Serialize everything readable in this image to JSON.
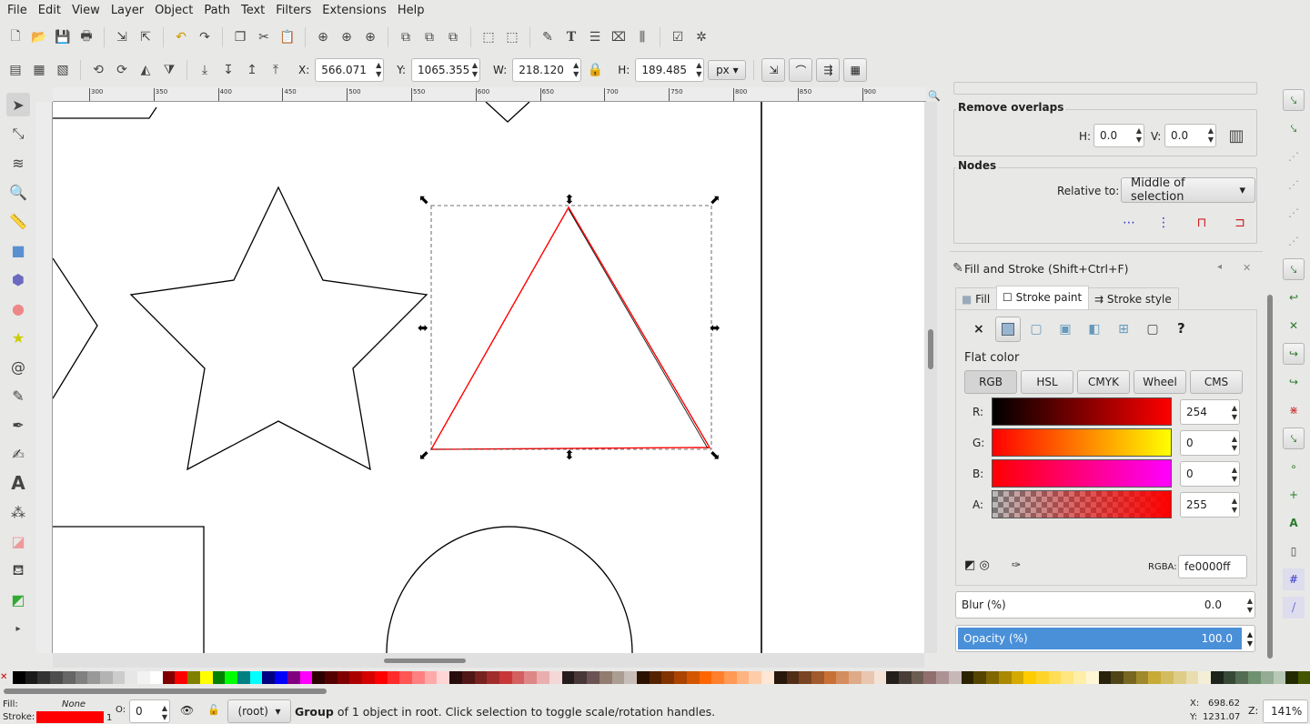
{
  "menu": [
    "File",
    "Edit",
    "View",
    "Layer",
    "Object",
    "Path",
    "Text",
    "Filters",
    "Extensions",
    "Help"
  ],
  "toolbar2": {
    "x_label": "X:",
    "x": "566.071",
    "y_label": "Y:",
    "y": "1065.355",
    "w_label": "W:",
    "w": "218.120",
    "h_label": "H:",
    "h": "189.485",
    "unit": "px"
  },
  "ruler": [
    "300",
    "350",
    "400",
    "450",
    "500",
    "550",
    "600",
    "650",
    "700",
    "750",
    "800",
    "850",
    "900"
  ],
  "align": {
    "remove_overlaps": "Remove overlaps",
    "h_label": "H:",
    "h": "0.0",
    "v_label": "V:",
    "v": "0.0",
    "nodes": "Nodes",
    "relative_label": "Relative to:",
    "relative_value": "Middle of selection"
  },
  "fill_stroke": {
    "title": "Fill and Stroke (Shift+Ctrl+F)",
    "tabs": [
      "Fill",
      "Stroke paint",
      "Stroke style"
    ],
    "active_tab": "Stroke paint",
    "paint_unknown": "?",
    "flat_color": "Flat color",
    "modes": [
      "RGB",
      "HSL",
      "CMYK",
      "Wheel",
      "CMS"
    ],
    "channels": [
      {
        "label": "R:",
        "value": "254"
      },
      {
        "label": "G:",
        "value": "0"
      },
      {
        "label": "B:",
        "value": "0"
      },
      {
        "label": "A:",
        "value": "255"
      }
    ],
    "rgba_label": "RGBA:",
    "rgba": "fe0000ff",
    "blur_label": "Blur (%)",
    "blur": "0.0",
    "opacity_label": "Opacity (%)",
    "opacity": "100.0"
  },
  "status": {
    "fill_label": "Fill:",
    "fill": "None",
    "stroke_label": "Stroke:",
    "stroke_color": "#ff0000",
    "stroke_width": "1",
    "o_label": "O:",
    "o": "0",
    "layer": "(root)",
    "message_bold": "Group",
    "message": " of 1 object in root. Click selection to toggle scale/rotation handles.",
    "x_label": "X:",
    "x": "698.62",
    "y_label": "Y:",
    "y": "1231.07",
    "z_label": "Z:",
    "zoom": "141%"
  },
  "colors": {
    "accent": "#4a90d9",
    "stroke": "#fe0000"
  },
  "palette": [
    "#000000",
    "#1a1a1a",
    "#333333",
    "#4d4d4d",
    "#666666",
    "#808080",
    "#999999",
    "#b3b3b3",
    "#cccccc",
    "#e6e6e6",
    "#f2f2f2",
    "#ffffff",
    "#800000",
    "#ff0000",
    "#808000",
    "#ffff00",
    "#008000",
    "#00ff00",
    "#008080",
    "#00ffff",
    "#000080",
    "#0000ff",
    "#800080",
    "#ff00ff",
    "#2b0000",
    "#550000",
    "#800000",
    "#aa0000",
    "#d40000",
    "#ff0000",
    "#ff2a2a",
    "#ff5555",
    "#ff8080",
    "#ffaaaa",
    "#ffd5d5",
    "#280b0b",
    "#501616",
    "#782121",
    "#a02c2c",
    "#c83737",
    "#d35f5f",
    "#de8787",
    "#e9afaf",
    "#f4d7d7",
    "#241c1c",
    "#483737",
    "#6c5353",
    "#917c6f",
    "#ac9d93",
    "#c8beb7",
    "#2b1100",
    "#552200",
    "#803300",
    "#aa4400",
    "#d45500",
    "#ff6600",
    "#ff7f2a",
    "#ff9955",
    "#ffb380",
    "#ffccaa",
    "#ffe6d5",
    "#28170b",
    "#502d16",
    "#784421",
    "#a05a2c",
    "#c87137",
    "#d38d5f",
    "#deaa87",
    "#e9c6af",
    "#f4e3d7",
    "#241f1c",
    "#483e37",
    "#6c5d53",
    "#916f6f",
    "#ac9393",
    "#c8b7b7",
    "#2b2200",
    "#554400",
    "#806600",
    "#aa8800",
    "#d4aa00",
    "#ffcc00",
    "#ffd42a",
    "#ffdd55",
    "#ffe680",
    "#ffeeaa",
    "#fff6d5",
    "#28220b",
    "#504416",
    "#786721",
    "#a0892c",
    "#c8ab37",
    "#d3bc5f",
    "#decd87",
    "#e9ddaf",
    "#f4eed7",
    "#1c241c",
    "#374837",
    "#536c53",
    "#6f916f",
    "#93ac93",
    "#b7c8b7",
    "#222b00",
    "#445500"
  ]
}
